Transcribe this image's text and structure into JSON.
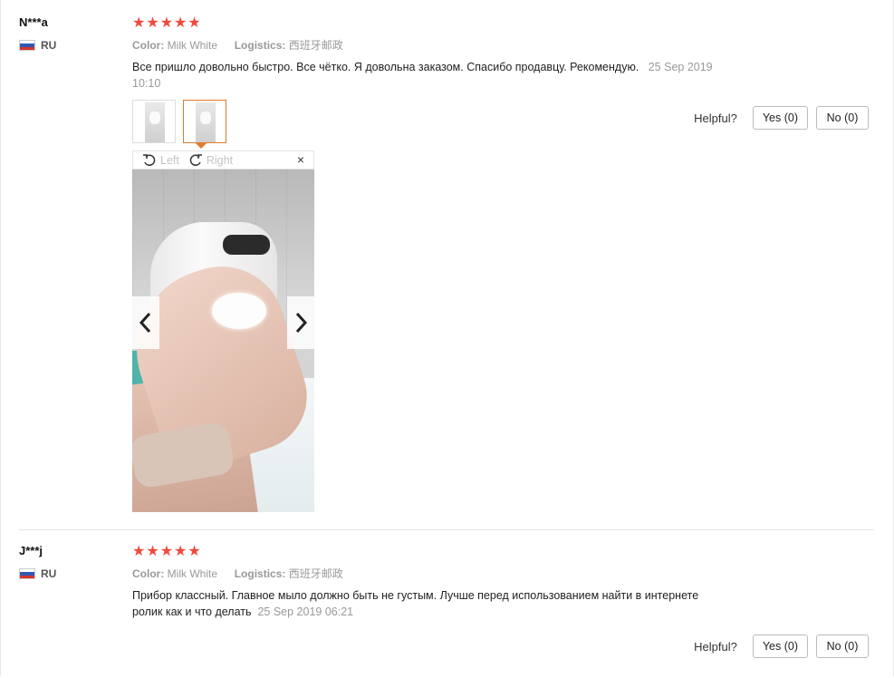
{
  "reviews": [
    {
      "user": "N***a",
      "country": "RU",
      "rating_stars": 5,
      "stars_text": "★★★★★",
      "color_label": "Color:",
      "color_value": "Milk White",
      "logistics_label": "Logistics:",
      "logistics_value": "西班牙邮政",
      "text": "Все пришло довольно быстро. Все чётко. Я довольна заказом. Спасибо продавцу. Рекомендую.",
      "date": "25 Sep 2019",
      "time": "10:10",
      "helpful_label": "Helpful?",
      "yes_label": "Yes (0)",
      "no_label": "No (0)",
      "viewer": {
        "rotate_left_label": "Left",
        "rotate_right_label": "Right",
        "close_label": "×"
      }
    },
    {
      "user": "J***j",
      "country": "RU",
      "rating_stars": 5,
      "stars_text": "★★★★★",
      "color_label": "Color:",
      "color_value": "Milk White",
      "logistics_label": "Logistics:",
      "logistics_value": "西班牙邮政",
      "text_line1": "Прибор классный. Главное мыло должно быть не густым. Лучше перед использованием найти в интернете",
      "text_line2": "ролик как и что делать",
      "date": "25 Sep 2019 06:21",
      "helpful_label": "Helpful?",
      "yes_label": "Yes (0)",
      "no_label": "No (0)"
    }
  ],
  "colors": {
    "star": "#f04a3d",
    "active_thumb_border": "#e07a2e",
    "muted_text": "#999999"
  }
}
